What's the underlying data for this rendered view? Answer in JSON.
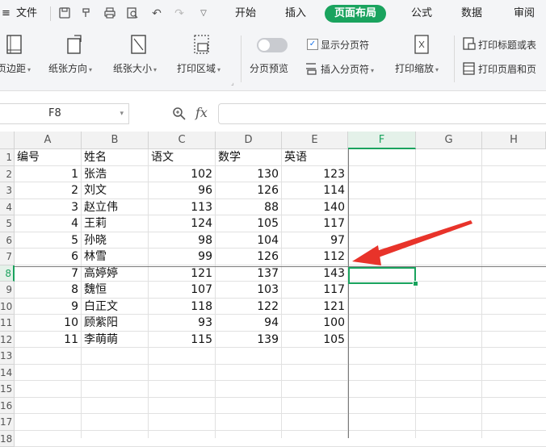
{
  "menu": {
    "file": "文件",
    "tabs": [
      "开始",
      "插入",
      "页面布局",
      "公式",
      "数据",
      "审阅"
    ],
    "active_tab": "页面布局",
    "accent": "#1aa35e"
  },
  "ribbon": {
    "margins": "页边距",
    "orientation": "纸张方向",
    "size": "纸张大小",
    "print_area": "打印区域",
    "page_break_preview": "分页预览",
    "show_page_breaks": "显示分页符",
    "insert_page_break": "插入分页符",
    "print_scale": "打印缩放",
    "print_titles": "打印标题或表",
    "header_footer": "打印页眉和页"
  },
  "formula_bar": {
    "cell_ref": "F8",
    "fx": "fx",
    "value": ""
  },
  "columns": [
    "A",
    "B",
    "C",
    "D",
    "E",
    "F",
    "G",
    "H"
  ],
  "selected_column": "F",
  "row_numbers": [
    "1",
    "2",
    "3",
    "4",
    "5",
    "6",
    "7",
    "8",
    "9",
    "10",
    "11",
    "12",
    "13",
    "14",
    "15",
    "16",
    "17",
    "18"
  ],
  "selected_row": "8",
  "table": {
    "headers": [
      "编号",
      "姓名",
      "语文",
      "数学",
      "英语"
    ],
    "rows": [
      [
        "1",
        "张浩",
        "102",
        "130",
        "123"
      ],
      [
        "2",
        "刘文",
        "96",
        "126",
        "114"
      ],
      [
        "3",
        "赵立伟",
        "113",
        "88",
        "140"
      ],
      [
        "4",
        "王莉",
        "124",
        "105",
        "117"
      ],
      [
        "5",
        "孙晓",
        "98",
        "104",
        "97"
      ],
      [
        "6",
        "林雪",
        "99",
        "126",
        "112"
      ],
      [
        "7",
        "高婷婷",
        "121",
        "137",
        "143"
      ],
      [
        "8",
        "魏恒",
        "107",
        "103",
        "117"
      ],
      [
        "9",
        "白正文",
        "118",
        "122",
        "121"
      ],
      [
        "10",
        "顾紫阳",
        "93",
        "94",
        "100"
      ],
      [
        "11",
        "李萌萌",
        "115",
        "139",
        "105"
      ]
    ]
  },
  "annotation_color": "#e8332a"
}
